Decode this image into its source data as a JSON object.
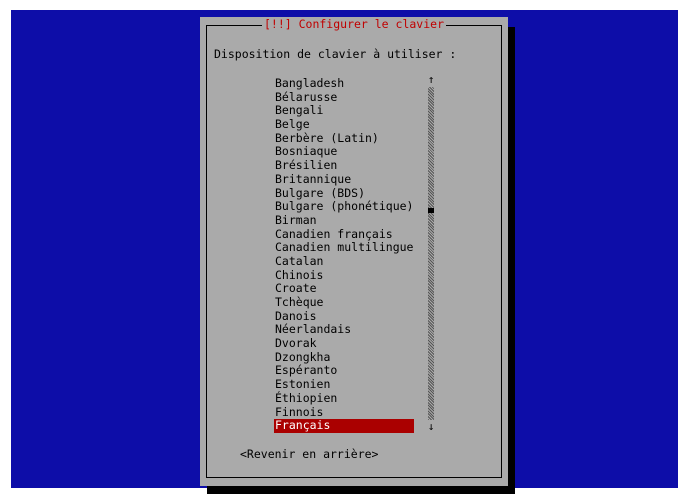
{
  "dialog": {
    "title": "[!!] Configurer le clavier",
    "prompt": "Disposition de clavier à utiliser :",
    "back_button": "<Revenir en arrière>"
  },
  "list": {
    "items": [
      "Bangladesh",
      "Bélarusse",
      "Bengali",
      "Belge",
      "Berbère (Latin)",
      "Bosniaque",
      "Brésilien",
      "Britannique",
      "Bulgare (BDS)",
      "Bulgare (phonétique)",
      "Birman",
      "Canadien français",
      "Canadien multilingue",
      "Catalan",
      "Chinois",
      "Croate",
      "Tchèque",
      "Danois",
      "Néerlandais",
      "Dvorak",
      "Dzongkha",
      "Espéranto",
      "Estonien",
      "Éthiopien",
      "Finnois",
      "Français"
    ],
    "selected_index": 25,
    "scroll_position": 0.37
  },
  "colors": {
    "background": "#0d0da8",
    "dialog": "#aaaaaa",
    "title": "#c00000",
    "selection": "#aa0000"
  },
  "icons": {
    "scroll_up": "up-arrow-icon",
    "scroll_down": "down-arrow-icon"
  }
}
